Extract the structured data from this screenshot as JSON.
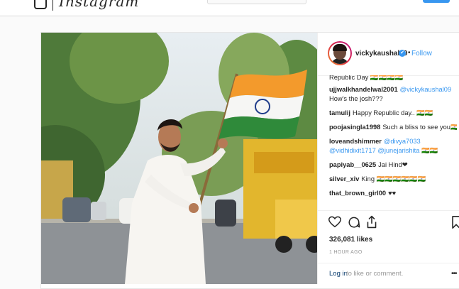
{
  "nav": {
    "logo_text": "Instagram"
  },
  "post": {
    "author": {
      "username": "vickykaushal09",
      "verified_glyph": "✔",
      "separator": "•",
      "follow_label": "Follow"
    },
    "comments": [
      {
        "user": "",
        "text": "Republic Day 🇮🇳🇮🇳🇮🇳🇮🇳"
      },
      {
        "user": "ujjwalkhandelwal2001",
        "mention": "@vickykaushal09",
        "text": "How's the josh???"
      },
      {
        "user": "tamulij",
        "text": "Happy Republic day.. 🇮🇳🇮🇳"
      },
      {
        "user": "poojasingla1998",
        "text": "Such a bliss to see you🇮🇳"
      },
      {
        "user": "loveandshimmer",
        "mention": "@divya7033",
        "mention2": "@vidhidixit1717",
        "mention3": "@junejarishita",
        "text": "🇮🇳🇮🇳"
      },
      {
        "user": "papiyab__0625",
        "text": "Jai Hind❤"
      },
      {
        "user": "silver_xiv",
        "text": "King 🇮🇳🇮🇳🇮🇳🇮🇳🇮🇳🇮🇳"
      },
      {
        "user": "that_brown_girl00",
        "text": "♥♥"
      }
    ],
    "likes_text": "326,081 likes",
    "timestamp": "1 HOUR AGO",
    "login": {
      "link": "Log in",
      "rest": "to like or comment.",
      "more": "•••"
    },
    "icons": [
      "heart-icon",
      "comment-icon",
      "share-icon",
      "bookmark-icon"
    ],
    "colors": {
      "link_blue": "#3897f0",
      "text": "#262626",
      "muted": "#999999"
    }
  }
}
